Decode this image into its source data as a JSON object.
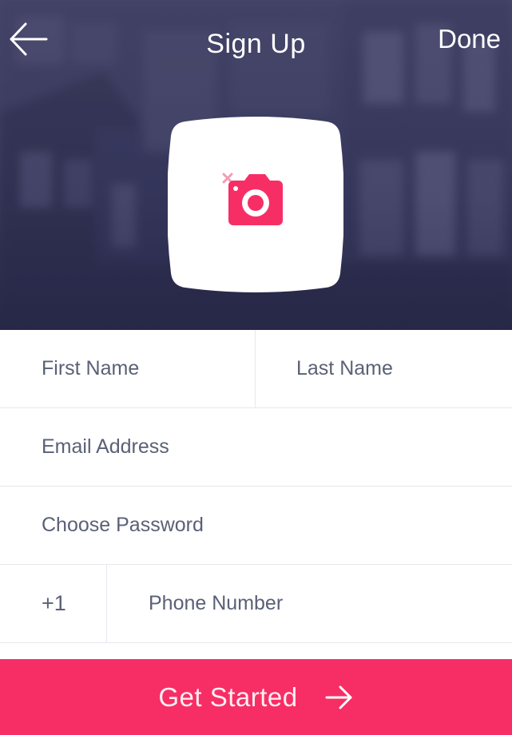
{
  "header": {
    "title": "Sign Up",
    "done_label": "Done",
    "back_icon": "arrow-left-icon"
  },
  "avatar": {
    "icon": "camera-icon",
    "badge_icon": "close-icon",
    "accent_color": "#f72e65"
  },
  "form": {
    "first_name": {
      "placeholder": "First Name",
      "value": ""
    },
    "last_name": {
      "placeholder": "Last Name",
      "value": ""
    },
    "email": {
      "placeholder": "Email Address",
      "value": ""
    },
    "password": {
      "placeholder": "Choose Password",
      "value": ""
    },
    "country_code": "+1",
    "phone": {
      "placeholder": "Phone Number",
      "value": ""
    }
  },
  "cta": {
    "label": "Get Started",
    "icon": "arrow-right-icon",
    "color": "#f72e65"
  }
}
